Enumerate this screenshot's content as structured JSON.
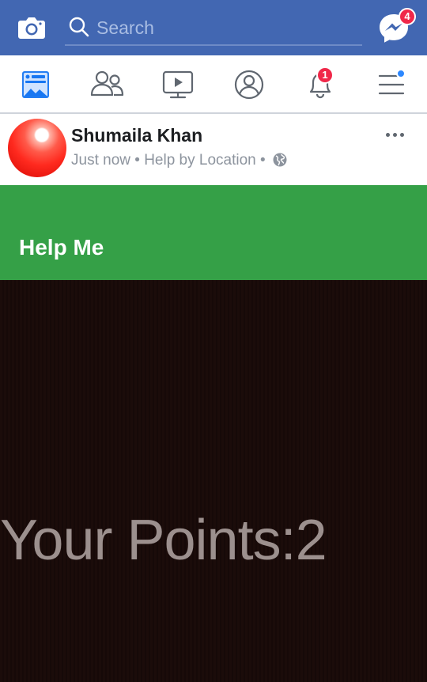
{
  "topbar": {
    "search_placeholder": "Search",
    "messenger_badge": "4",
    "icons": {
      "camera": "camera-icon",
      "search": "search-icon",
      "messenger": "messenger-icon"
    }
  },
  "nav": {
    "items": [
      {
        "name": "news-feed",
        "icon": "news-feed-icon"
      },
      {
        "name": "friends",
        "icon": "friends-icon"
      },
      {
        "name": "watch",
        "icon": "watch-icon"
      },
      {
        "name": "profile",
        "icon": "profile-icon"
      },
      {
        "name": "notifications",
        "icon": "bell-icon",
        "badge": "1"
      },
      {
        "name": "menu",
        "icon": "menu-icon"
      }
    ]
  },
  "post": {
    "author": "Shumaila Khan",
    "time": "Just now",
    "separator": "•",
    "category": "Help by Location",
    "privacy_icon": "globe-icon"
  },
  "banner": {
    "label": "Help Me"
  },
  "game": {
    "points_text": "Your Points:2"
  },
  "colors": {
    "brand_blue": "#4267b2",
    "banner_green": "#35a047",
    "game_bg": "#1b0c0a",
    "badge_red": "#f02849"
  }
}
